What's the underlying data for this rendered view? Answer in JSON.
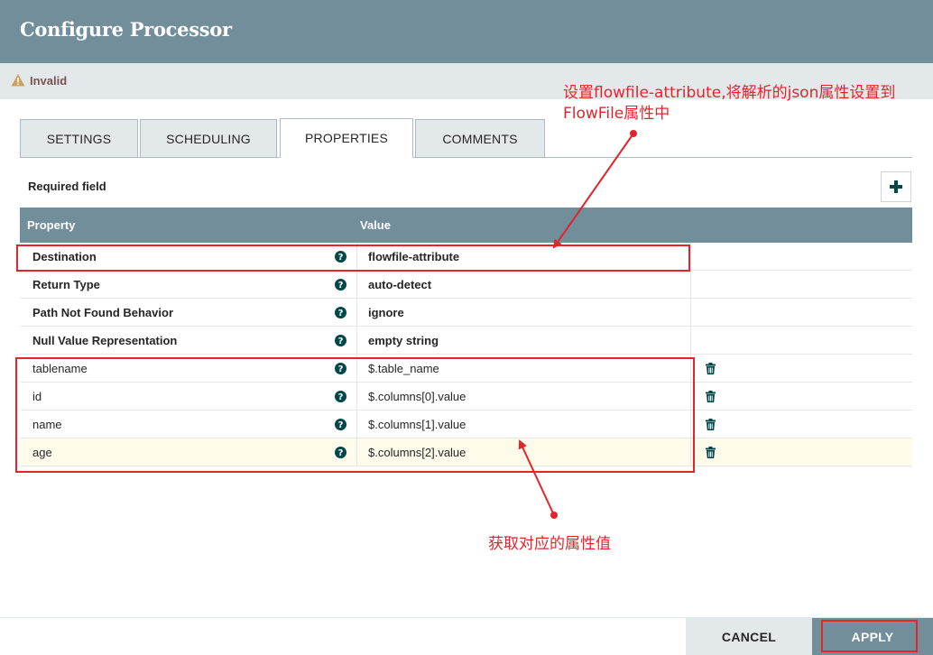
{
  "dialog": {
    "title": "Configure Processor",
    "status": "Invalid",
    "status_icon": "warning-icon",
    "accent_color": "#728e9b"
  },
  "tabs": [
    {
      "label": "SETTINGS",
      "active": false
    },
    {
      "label": "SCHEDULING",
      "active": false
    },
    {
      "label": "PROPERTIES",
      "active": true
    },
    {
      "label": "COMMENTS",
      "active": false
    }
  ],
  "properties": {
    "required_label": "Required field",
    "add_icon": "plus-icon",
    "columns": {
      "property": "Property",
      "value": "Value"
    },
    "rows": [
      {
        "name": "Destination",
        "value": "flowfile-attribute",
        "required": true
      },
      {
        "name": "Return Type",
        "value": "auto-detect",
        "required": true
      },
      {
        "name": "Path Not Found Behavior",
        "value": "ignore",
        "required": true
      },
      {
        "name": "Null Value Representation",
        "value": "empty string",
        "required": true
      },
      {
        "name": "tablename",
        "value": "$.table_name",
        "required": false
      },
      {
        "name": "id",
        "value": "$.columns[0].value",
        "required": false
      },
      {
        "name": "name",
        "value": "$.columns[1].value",
        "required": false
      },
      {
        "name": "age",
        "value": "$.columns[2].value",
        "required": false
      }
    ]
  },
  "annotations": {
    "top_note": "设置flowfile-attribute,将解析的json属性设置到FlowFile属性中",
    "bottom_note": "获取对应的属性值",
    "color": "#e3242b"
  },
  "footer": {
    "cancel_label": "CANCEL",
    "apply_label": "APPLY"
  }
}
